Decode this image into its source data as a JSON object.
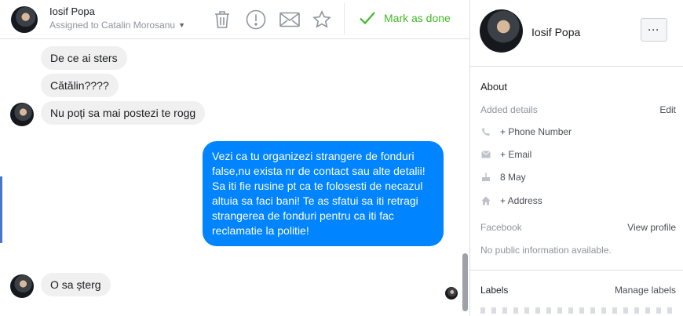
{
  "header": {
    "contact_name": "Iosif Popa",
    "assigned_text": "Assigned to Catalin Morosanu",
    "icons": [
      "trash-icon",
      "alert-circle-icon",
      "mail-icon",
      "star-icon"
    ],
    "mark_done_label": "Mark as done",
    "mark_done_color": "#42b72a"
  },
  "messages": {
    "incoming_1": "De ce ai sters",
    "incoming_2": "Cătălin????",
    "incoming_3": "Nu poți sa mai postezi te rogg",
    "outgoing_1": "Vezi ca tu organizezi strangere de fonduri false,nu exista nr de contact sau alte detalii! Sa iti fie rusine pt ca te folosesti de necazul altuia sa faci bani! Te as sfatui sa iti retragi strangerea de fonduri pentru ca iti fac reclamatie la politie!",
    "incoming_4": "O sa șterg",
    "outgoing_color": "#0084ff"
  },
  "profile": {
    "name": "Iosif Popa",
    "more_label": "···",
    "about_title": "About",
    "added_details_label": "Added details",
    "edit_label": "Edit",
    "phone_label": "+ Phone Number",
    "email_label": "+ Email",
    "birthday": "8 May",
    "address_label": "+ Address",
    "facebook_title": "Facebook",
    "view_profile_label": "View profile",
    "no_public_info": "No public information available.",
    "labels_title": "Labels",
    "manage_labels_label": "Manage labels"
  }
}
